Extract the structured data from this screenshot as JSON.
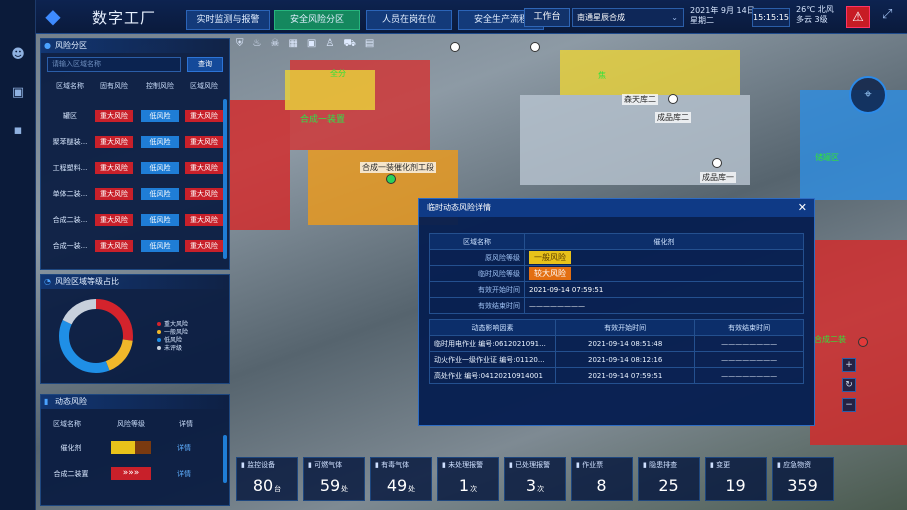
{
  "app": {
    "title": "数字工厂"
  },
  "nav": {
    "tabs": [
      "实时监测与报警",
      "安全风险分区",
      "人员在岗在位",
      "安全生产流程"
    ],
    "active": "安全风险分区"
  },
  "header": {
    "workbench": "工作台",
    "site": "南通星辰合成",
    "date": "2021年 9月 14日",
    "weekday": "星期二",
    "time": "15:15:15",
    "temp": "26℃",
    "weather": "多云",
    "wind_dir": "北风",
    "wind_level": "3级"
  },
  "risk_zone": {
    "title": "风险分区",
    "search_placeholder": "请输入区域名称",
    "search_btn": "查询",
    "columns": [
      "区域名称",
      "固有风险",
      "控制风险",
      "区域风险"
    ],
    "rows": [
      {
        "name": "罐区",
        "inherent": "重大风险",
        "control": "低风险",
        "zone": "重大风险"
      },
      {
        "name": "聚苯醚装...",
        "inherent": "重大风险",
        "control": "低风险",
        "zone": "重大风险"
      },
      {
        "name": "工程塑料...",
        "inherent": "重大风险",
        "control": "低风险",
        "zone": "重大风险"
      },
      {
        "name": "单体二装...",
        "inherent": "重大风险",
        "control": "低风险",
        "zone": "重大风险"
      },
      {
        "name": "合成二装...",
        "inherent": "重大风险",
        "control": "低风险",
        "zone": "重大风险"
      },
      {
        "name": "合成一装...",
        "inherent": "重大风险",
        "control": "低风险",
        "zone": "重大风险"
      }
    ]
  },
  "ratio": {
    "title": "风险区域等级占比",
    "legend": [
      "重大风险",
      "一般风险",
      "低风险",
      "未评级"
    ],
    "colors": [
      "#d4232c",
      "#f0b72a",
      "#1f8fe6",
      "#c8d0dc"
    ],
    "values": [
      0.27,
      0.17,
      0.38,
      0.18
    ]
  },
  "dynamic": {
    "title": "动态风险",
    "columns": [
      "区域名称",
      "风险等级",
      "详情"
    ],
    "rows": [
      {
        "name": "催化剂",
        "level": "general",
        "detail": "详情"
      },
      {
        "name": "合成二装置",
        "level": "major",
        "detail": "详情"
      }
    ]
  },
  "map": {
    "labels": [
      "合成一装置",
      "合成一装置",
      "全分",
      "合成二装",
      "罐区",
      "合成二装",
      "焦",
      "成品库二",
      "成品库一",
      "森天库二",
      "储罐区"
    ],
    "white_labels": [
      "合成一装催化剂工段",
      "成品库二",
      "成品库一",
      "森天库二"
    ]
  },
  "modal": {
    "title": "临时动态风险详情",
    "head": [
      "区域名称",
      "催化剂"
    ],
    "rows": [
      {
        "label": "原风险等级",
        "value": "一般风险",
        "color": "#e8c21a"
      },
      {
        "label": "临时风险等级",
        "value": "较大风险",
        "color": "#e36f12"
      },
      {
        "label": "有效开始时间",
        "value": "2021-09-14 07:59:51"
      },
      {
        "label": "有效结束时间",
        "value": "————————"
      }
    ],
    "factor_cols": [
      "动态影响因素",
      "有效开始时间",
      "有效结束时间"
    ],
    "factors": [
      {
        "name": "临时用电作业 编号:0612021091...",
        "start": "2021-09-14 08:51:48",
        "end": "————————"
      },
      {
        "name": "动火作业一级作业证 编号:01120...",
        "start": "2021-09-14 08:12:16",
        "end": "————————"
      },
      {
        "name": "高处作业 编号:04120210914001",
        "start": "2021-09-14 07:59:51",
        "end": "————————"
      }
    ]
  },
  "stats": [
    {
      "label": "监控设备",
      "value": "80",
      "unit": "台"
    },
    {
      "label": "可燃气体",
      "value": "59",
      "unit": "处"
    },
    {
      "label": "有毒气体",
      "value": "49",
      "unit": "处"
    },
    {
      "label": "未处理报警",
      "value": "1",
      "unit": "次"
    },
    {
      "label": "已处理报警",
      "value": "3",
      "unit": "次"
    },
    {
      "label": "作业票",
      "value": "8",
      "unit": ""
    },
    {
      "label": "隐患排查",
      "value": "25",
      "unit": ""
    },
    {
      "label": "变更",
      "value": "19",
      "unit": ""
    },
    {
      "label": "应急物资",
      "value": "359",
      "unit": ""
    }
  ]
}
